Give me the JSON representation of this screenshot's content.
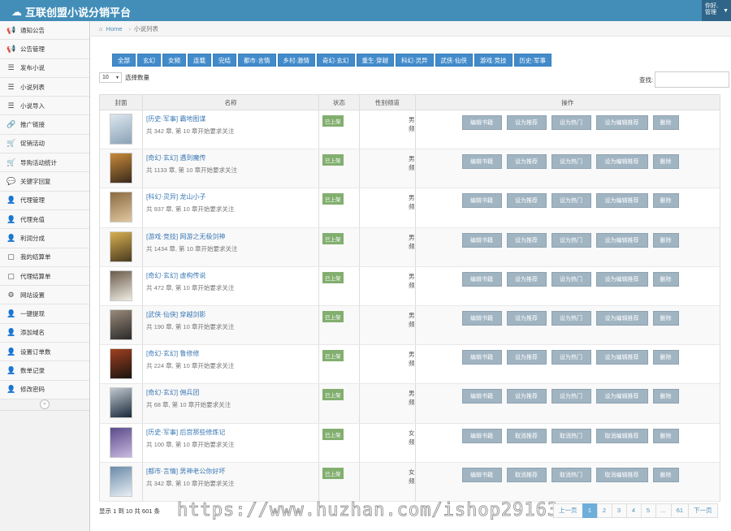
{
  "app": {
    "title": "互联创盟小说分销平台",
    "user_line1": "你好,",
    "user_line2": "管理"
  },
  "colors": {
    "topbar": "#438eb9",
    "filter_btn": "#428bca",
    "status": "#82af6f",
    "op_btn": "#a0b4c2",
    "link": "#3a78b5"
  },
  "sidebar": {
    "items": [
      {
        "label": "通知公告",
        "icon": "megaphone-icon",
        "glyph": "📢"
      },
      {
        "label": "公告管理",
        "icon": "megaphone-icon",
        "glyph": "📢"
      },
      {
        "label": "发布小说",
        "icon": "list-icon",
        "glyph": "☰"
      },
      {
        "label": "小说列表",
        "icon": "list-icon",
        "glyph": "☰"
      },
      {
        "label": "小说导入",
        "icon": "list-icon",
        "glyph": "☰"
      },
      {
        "label": "推广链接",
        "icon": "link-icon",
        "glyph": "🔗"
      },
      {
        "label": "促销活动",
        "icon": "cart-icon",
        "glyph": "🛒"
      },
      {
        "label": "导购活动统计",
        "icon": "cart-icon",
        "glyph": "🛒"
      },
      {
        "label": "关键字回复",
        "icon": "chat-icon",
        "glyph": "💬"
      },
      {
        "label": "代理管理",
        "icon": "user-plus-icon",
        "glyph": "👤"
      },
      {
        "label": "代理充值",
        "icon": "user-plus-icon",
        "glyph": "👤"
      },
      {
        "label": "利润分成",
        "icon": "user-plus-icon",
        "glyph": "👤"
      },
      {
        "label": "我的结算单",
        "icon": "document-icon",
        "glyph": "▢"
      },
      {
        "label": "代理结算单",
        "icon": "document-icon",
        "glyph": "▢"
      },
      {
        "label": "网站设置",
        "icon": "gears-icon",
        "glyph": "⚙"
      },
      {
        "label": "一键提现",
        "icon": "user-plus-icon",
        "glyph": "👤"
      },
      {
        "label": "添加域名",
        "icon": "user-plus-icon",
        "glyph": "👤"
      },
      {
        "label": "设置订单数",
        "icon": "user-plus-icon",
        "glyph": "👤"
      },
      {
        "label": "数单记录",
        "icon": "user-plus-icon",
        "glyph": "👤"
      },
      {
        "label": "修改密码",
        "icon": "user-plus-icon",
        "glyph": "👤"
      }
    ],
    "collapse": "«"
  },
  "breadcrumb": {
    "home": "Home",
    "current": "小说列表"
  },
  "filters": [
    "全部",
    "玄幻",
    "女频",
    "连载",
    "完结",
    "都市·言情",
    "乡村·激情",
    "奇幻·玄幻",
    "重生·穿越",
    "科幻·灵异",
    "武侠·仙侠",
    "游戏·竞技",
    "历史·军事"
  ],
  "table_controls": {
    "length": "10",
    "length_label": "选择数量",
    "search_label": "查找:"
  },
  "columns": [
    "封面",
    "名称",
    "状态",
    "性别频道",
    "操作"
  ],
  "rows": [
    {
      "title": "[历史·军事] 霸地图谋",
      "meta": "共 342 章, 第 10 章开始要求关注",
      "status": "已上架",
      "gender": "男频",
      "ops": [
        "编辑书籍",
        "设为推荐",
        "设为热门",
        "设为编辑推荐",
        "删除"
      ],
      "cover": [
        "#8aa3b8",
        "#dde6ee"
      ]
    },
    {
      "title": "[奇幻·玄幻] 遇到魔传",
      "meta": "共 1133 章, 第 10 章开始要求关注",
      "status": "已上架",
      "gender": "男频",
      "ops": [
        "编辑书籍",
        "设为推荐",
        "设为热门",
        "设为编辑推荐",
        "删除"
      ],
      "cover": [
        "#3a2a1c",
        "#c88a3a"
      ]
    },
    {
      "title": "[科幻·灵异] 龙山小子",
      "meta": "共 937 章, 第 10 章开始要求关注",
      "status": "已上架",
      "gender": "男频",
      "ops": [
        "编辑书籍",
        "设为推荐",
        "设为热门",
        "设为编辑推荐",
        "删除"
      ],
      "cover": [
        "#e0c8a0",
        "#8b6a40"
      ]
    },
    {
      "title": "[游戏·竞技] 网游之无极剑神",
      "meta": "共 1434 章, 第 10 章开始要求关注",
      "status": "已上架",
      "gender": "男频",
      "ops": [
        "编辑书籍",
        "设为推荐",
        "设为热门",
        "设为编辑推荐",
        "删除"
      ],
      "cover": [
        "#4a3a20",
        "#d8b050"
      ]
    },
    {
      "title": "[奇幻·玄幻] 虚构传说",
      "meta": "共 472 章, 第 10 章开始要求关注",
      "status": "已上架",
      "gender": "男频",
      "ops": [
        "编辑书籍",
        "设为推荐",
        "设为热门",
        "设为编辑推荐",
        "删除"
      ],
      "cover": [
        "#f0ece4",
        "#6a5a4a"
      ]
    },
    {
      "title": "[武侠·仙侠] 穿越剑影",
      "meta": "共 190 章, 第 10 章开始要求关注",
      "status": "已上架",
      "gender": "男频",
      "ops": [
        "编辑书籍",
        "设为推荐",
        "设为热门",
        "设为编辑推荐",
        "删除"
      ],
      "cover": [
        "#2a2a2a",
        "#9a8a7a"
      ]
    },
    {
      "title": "[奇幻·玄幻] 鲁修修",
      "meta": "共 224 章, 第 10 章开始要求关注",
      "status": "已上架",
      "gender": "男频",
      "ops": [
        "编辑书籍",
        "设为推荐",
        "设为热门",
        "设为编辑推荐",
        "删除"
      ],
      "cover": [
        "#1a1410",
        "#a04020"
      ]
    },
    {
      "title": "[奇幻·玄幻] 佣兵团",
      "meta": "共 68 章, 第 10 章开始要求关注",
      "status": "已上架",
      "gender": "男频",
      "ops": [
        "编辑书籍",
        "设为推荐",
        "设为热门",
        "设为编辑推荐",
        "删除"
      ],
      "cover": [
        "#1a2a3a",
        "#c0c8d0"
      ]
    },
    {
      "title": "[历史·军事] 后宫那些修炼记",
      "meta": "共 100 章, 第 10 章开始要求关注",
      "status": "已上架",
      "gender": "女频",
      "ops": [
        "编辑书籍",
        "取消推荐",
        "取消热门",
        "取消编辑推荐",
        "删除"
      ],
      "cover": [
        "#c8b8e0",
        "#5a4a8a"
      ]
    },
    {
      "title": "[都市·言情] 男神老公你好坏",
      "meta": "共 342 章, 第 10 章开始要求关注",
      "status": "已上架",
      "gender": "女频",
      "ops": [
        "编辑书籍",
        "取消推荐",
        "取消热门",
        "取消编辑推荐",
        "删除"
      ],
      "cover": [
        "#e8eef4",
        "#6a8aa8"
      ]
    }
  ],
  "footer": {
    "info": "显示 1 到 10 共 601 条",
    "watermark": "https://www.huzhan.com/ishop29163"
  },
  "pagination": {
    "prev": "上一页",
    "pages": [
      "1",
      "2",
      "3",
      "4",
      "5",
      "...",
      "61"
    ],
    "next": "下一页",
    "active": "1"
  }
}
